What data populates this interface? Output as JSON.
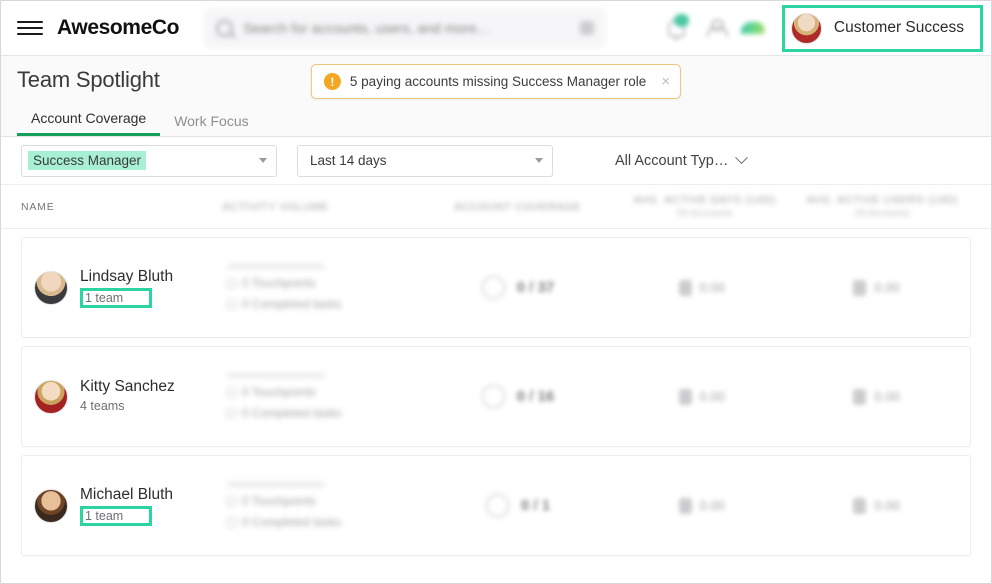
{
  "topbar": {
    "brand": "AwesomeCo",
    "search_placeholder": "Search for accounts, users, and more...",
    "search_value": "",
    "user_name": "Customer Success"
  },
  "page": {
    "title": "Team Spotlight",
    "alert": {
      "text": "5 paying accounts missing Success Manager role",
      "close": "×",
      "icon_color": "#f5a623"
    }
  },
  "tabs": [
    {
      "label": "Account Coverage",
      "active": true
    },
    {
      "label": "Work Focus",
      "active": false
    }
  ],
  "filters": {
    "role": {
      "value": "Success Manager",
      "highlight_color": "#a8f0d4"
    },
    "date_range": {
      "value": "Last 14 days"
    },
    "account_type": {
      "value": "All Account Typ…"
    }
  },
  "table": {
    "columns": [
      {
        "label": "NAME",
        "sub": ""
      },
      {
        "label": "ACTIVITY VOLUME",
        "sub": ""
      },
      {
        "label": "ACCOUNT COVERAGE",
        "sub": ""
      },
      {
        "label": "AVG. ACTIVE DAYS (14D)",
        "sub": "Of Accounts"
      },
      {
        "label": "AVG. ACTIVE USERS (14D)",
        "sub": "Of Accounts"
      }
    ],
    "rows": [
      {
        "name": "Lindsay Bluth",
        "teams": "1 team",
        "teams_highlighted": true,
        "touchpoints": "0 Touchpoints",
        "tasks": "0 Completed tasks",
        "coverage": "0 / 37",
        "avg_active_days": "0.00",
        "avg_active_users": "0.00"
      },
      {
        "name": "Kitty Sanchez",
        "teams": "4 teams",
        "teams_highlighted": false,
        "touchpoints": "0 Touchpoints",
        "tasks": "0 Completed tasks",
        "coverage": "0 / 16",
        "avg_active_days": "0.00",
        "avg_active_users": "0.00"
      },
      {
        "name": "Michael Bluth",
        "teams": "1 team",
        "teams_highlighted": true,
        "touchpoints": "0 Touchpoints",
        "tasks": "0 Completed tasks",
        "coverage": "0 / 1",
        "avg_active_days": "0.00",
        "avg_active_users": "0.00"
      }
    ]
  },
  "theme": {
    "highlight_teal": "#2ad5a2",
    "tab_green": "#13a05a",
    "mint": "#a8f0d4"
  }
}
